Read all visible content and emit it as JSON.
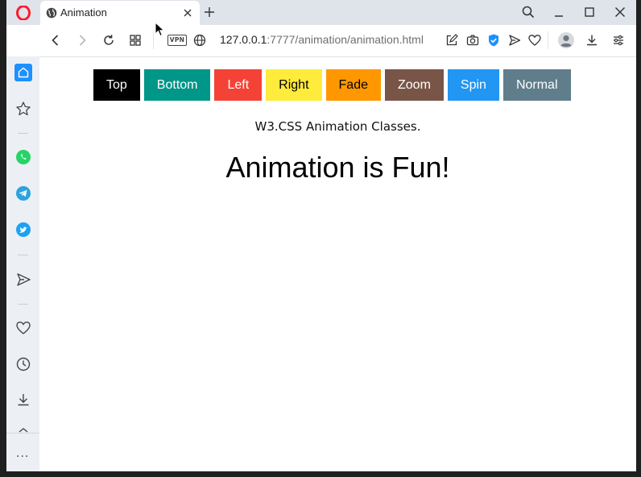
{
  "browser": {
    "tab": {
      "title": "Animation"
    },
    "url": {
      "host": "127.0.0.1",
      "rest": ":7777/animation/animation.html"
    },
    "vpn_label": "VPN",
    "more_label": "···"
  },
  "page": {
    "buttons": [
      {
        "label": "Top",
        "bg": "#000000",
        "fg": "#ffffff"
      },
      {
        "label": "Bottom",
        "bg": "#009688",
        "fg": "#ffffff"
      },
      {
        "label": "Left",
        "bg": "#f44336",
        "fg": "#ffffff"
      },
      {
        "label": "Right",
        "bg": "#ffeb3b",
        "fg": "#000000"
      },
      {
        "label": "Fade",
        "bg": "#ff9800",
        "fg": "#000000"
      },
      {
        "label": "Zoom",
        "bg": "#795548",
        "fg": "#ffffff"
      },
      {
        "label": "Spin",
        "bg": "#2196f3",
        "fg": "#ffffff"
      },
      {
        "label": "Normal",
        "bg": "#607d8b",
        "fg": "#ffffff"
      }
    ],
    "subtitle": "W3.CSS Animation Classes.",
    "headline": "Animation is Fun!"
  },
  "colors": {
    "opera_red": "#ff1b2d",
    "sidebar_accent": "#1e90ff",
    "whatsapp": "#25d366",
    "telegram": "#2aa3df",
    "twitter": "#1da1f2"
  }
}
